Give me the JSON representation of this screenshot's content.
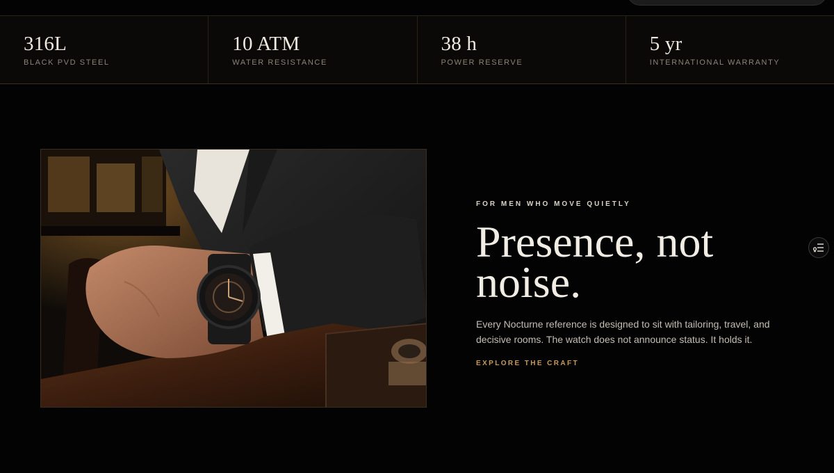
{
  "stats": [
    {
      "value": "316L",
      "label": "BLACK PVD STEEL"
    },
    {
      "value": "10 ATM",
      "label": "WATER RESISTANCE"
    },
    {
      "value": "38 h",
      "label": "POWER RESERVE"
    },
    {
      "value": "5 yr",
      "label": "INTERNATIONAL WARRANTY"
    }
  ],
  "feature": {
    "eyebrow": "FOR MEN WHO MOVE QUIETLY",
    "headline_line1": "Presence, not",
    "headline_line2": "noise.",
    "body": "Every Nocturne reference is designed to sit with tailoring, travel, and decisive rooms. The watch does not announce status. It holds it.",
    "cta": "EXPLORE THE CRAFT"
  },
  "floating_button": {
    "icon": "filter-list-icon"
  },
  "colors": {
    "accent": "#c79a5c",
    "background": "#030303",
    "text": "#f2ede4"
  }
}
